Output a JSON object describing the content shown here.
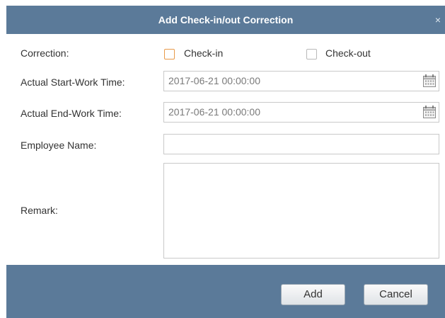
{
  "dialog": {
    "title": "Add Check-in/out Correction",
    "close_glyph": "×"
  },
  "form": {
    "correction_label": "Correction:",
    "checkin_label": "Check-in",
    "checkin_checked": false,
    "checkout_label": "Check-out",
    "checkout_checked": false,
    "start_label": "Actual Start-Work Time:",
    "start_value": "2017-06-21 00:00:00",
    "end_label": "Actual End-Work Time:",
    "end_value": "2017-06-21 00:00:00",
    "employee_label": "Employee Name:",
    "employee_value": "",
    "remark_label": "Remark:",
    "remark_value": ""
  },
  "footer": {
    "add_label": "Add",
    "cancel_label": "Cancel"
  },
  "icons": {
    "calendar": "calendar-icon",
    "close": "close-icon"
  },
  "colors": {
    "titlebar": "#5b7a99",
    "footer": "#5b7a99",
    "checkin_accent": "#e89a4a"
  }
}
